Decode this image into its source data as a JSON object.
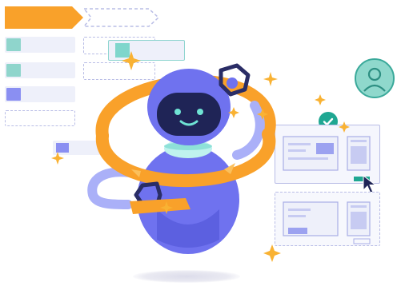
{
  "colors": {
    "orange": "#f9a12a",
    "indigo": "#6c6ff0",
    "indigo_dark": "#2a2d66",
    "teal": "#7fd6cc",
    "panel": "#eef0fa",
    "dash": "#b9bde6"
  },
  "icons": [
    "user-avatar-icon",
    "checkmark-icon",
    "cursor-arrow-icon",
    "sparkle-icon",
    "wrench-icon"
  ],
  "left_rows": [
    {
      "swatch": "#8fd5cc"
    },
    {
      "swatch": "#8fd5cc"
    },
    {
      "swatch": "#8a8ff2"
    }
  ]
}
